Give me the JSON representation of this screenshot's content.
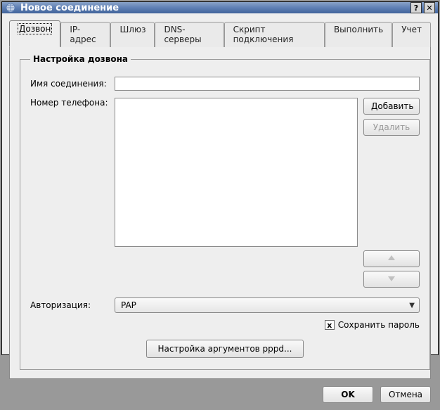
{
  "window": {
    "title": "Новое соединение"
  },
  "titlebar_buttons": {
    "help": "?",
    "close": "✕"
  },
  "tabs": {
    "dial": "Дозвон",
    "ip": "IP-адрес",
    "gateway": "Шлюз",
    "dns": "DNS-серверы",
    "script": "Скрипт подключения",
    "execute": "Выполнить",
    "account": "Учет"
  },
  "group": {
    "legend": "Настройка дозвона",
    "conn_name_label": "Имя соединения:",
    "conn_name_value": "",
    "phone_label": "Номер телефона:",
    "add_button": "Добавить",
    "delete_button": "Удалить",
    "auth_label": "Авторизация:",
    "auth_value": "PAP",
    "save_password_label": "Сохранить пароль",
    "save_password_checked": "x",
    "pppd_button": "Настройка аргументов pppd..."
  },
  "dialog": {
    "ok": "OK",
    "cancel": "Отмена"
  }
}
